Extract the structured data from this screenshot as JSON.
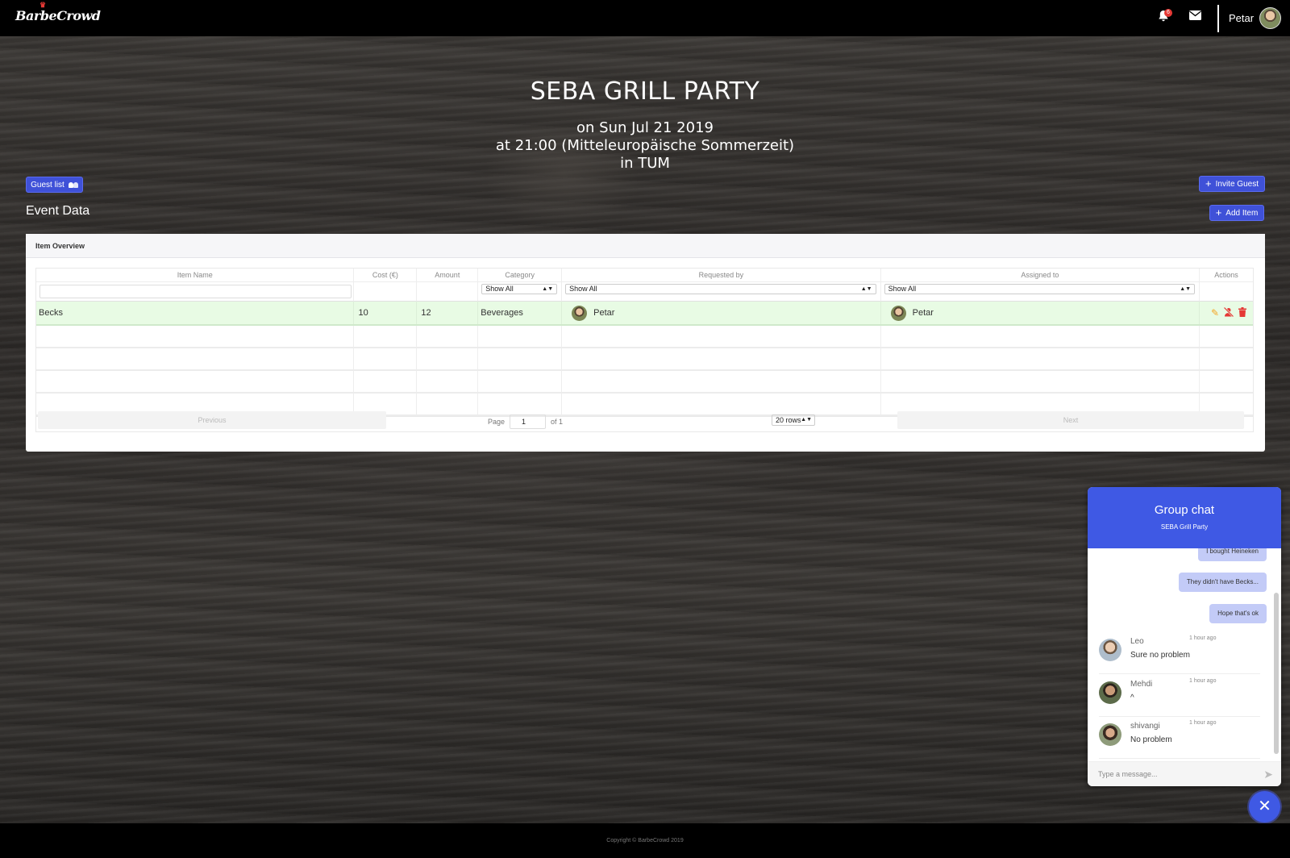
{
  "navbar": {
    "logo": "BarbeCrowd",
    "notification_count": "6",
    "user_name": "Petar"
  },
  "event": {
    "title": "SEBA GRILL PARTY",
    "date_line": "on Sun Jul 21 2019",
    "time_line": "at 21:00 (Mitteleuropäische Sommerzeit)",
    "location_line": "in TUM"
  },
  "buttons": {
    "guest_list": "Guest list",
    "invite_guest": "Invite Guest",
    "add_item": "Add Item"
  },
  "section_title": "Event Data",
  "table": {
    "card_title": "Item Overview",
    "columns": [
      "Item Name",
      "Cost (€)",
      "Amount",
      "Category",
      "Requested by",
      "Assigned to",
      "Actions"
    ],
    "filters": {
      "category": "Show All",
      "requested_by": "Show All",
      "assigned_to": "Show All"
    },
    "rows": [
      {
        "item_name": "Becks",
        "cost": "10",
        "amount": "12",
        "category": "Beverages",
        "requested_by": "Petar",
        "assigned_to": "Petar"
      }
    ],
    "pagination": {
      "previous": "Previous",
      "next": "Next",
      "page_label": "Page",
      "page_value": "1",
      "of_label": "of 1",
      "rows_option": "20 rows"
    }
  },
  "chat": {
    "title": "Group chat",
    "subtitle": "SEBA Grill Party",
    "own_messages": [
      "I bought Heineken",
      "They didn't have Becks...",
      "Hope that's ok"
    ],
    "messages": [
      {
        "name": "Leo",
        "time": "1 hour ago",
        "text": "Sure no problem"
      },
      {
        "name": "Mehdi",
        "time": "1 hour ago",
        "text": "^"
      },
      {
        "name": "shivangi",
        "time": "1 hour ago",
        "text": "No problem"
      }
    ],
    "input_placeholder": "Type a message...",
    "close_icon": "close-icon"
  },
  "footer": {
    "copyright": "Copyright © BarbeCrowd 2019"
  },
  "colors": {
    "accent": "#3f51d8",
    "chat_header": "#3f59e4",
    "row_highlight": "#e8fbe4",
    "danger": "#e53935",
    "warning": "#f5a623"
  }
}
